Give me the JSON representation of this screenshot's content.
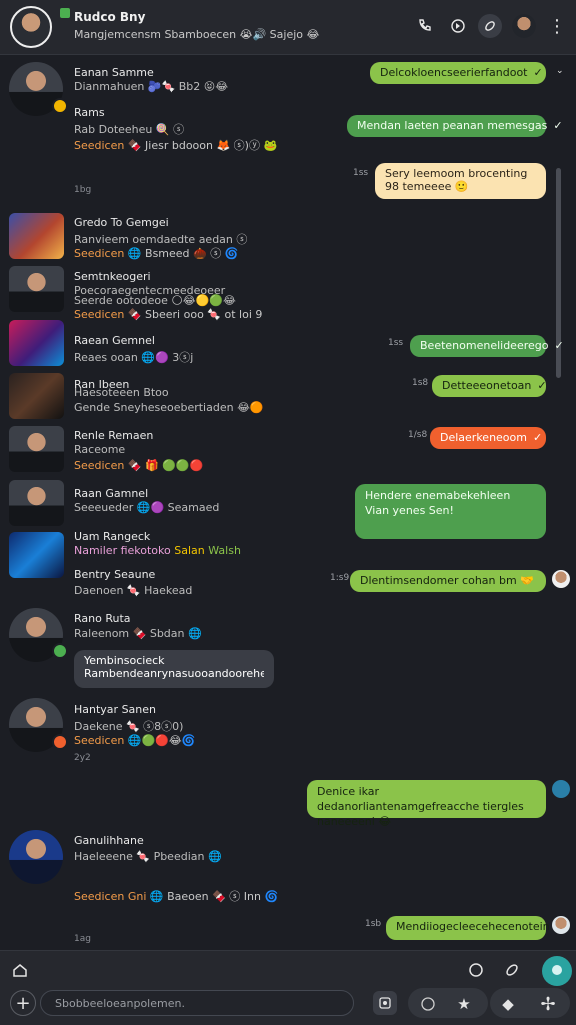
{
  "header": {
    "title": "Rudco Bny",
    "subtitle": "Mangjemcensm Sbamboecen 😭🔊 Sajejo 😂"
  },
  "chats": [
    {
      "name": "Eanan Samme",
      "line2": "Dianmahuen 🫐🍬 Bb2 😝😂",
      "time": ""
    },
    {
      "name": "Rams",
      "line2": "Rab Doteeheu 🍭 ⓢ",
      "line3a": "Seedicen",
      "line3b": " 🍫 Jiesr bdooon 🦊 ⓢ)ⓨ 🐸",
      "time": "1bg"
    },
    {
      "name": "Gredo To Gemgei",
      "line2": "Ranvieem oemdaedte aedan ⓢ",
      "line3a": "Seedicen",
      "line3b": " 🌐 Bsmeed 🌰 ⓢ 🌀",
      "time": ""
    },
    {
      "name": "Semtnkeogeri",
      "line2": "Poecoraegentecmeedeoeer",
      "line2b": "Seerde ootodeoe 🌕😂🟡🟢😂",
      "line3a": "Seedicen",
      "line3b": " 🍫 Sbeeri ooo 🍬 ot loi 9",
      "time": ""
    },
    {
      "name": "Raean Gemnel",
      "line2": "Reaes ooan 🌐🟣 3ⓢj",
      "time": ""
    },
    {
      "name": "Ran Ibeen",
      "line2": "Haesoteeen Btoo",
      "line2b": "Gende Sneyheseoebertiaden 😂🟠",
      "time": ""
    },
    {
      "name": "Renle Remaen",
      "line2": "Raceome",
      "line3a": "Seedicen",
      "line3b": " 🍫 🎁 🟢🟢🔴",
      "time": ""
    },
    {
      "name": "Raan Gamnel",
      "line2": "Seeeueder 🌐🟣 Seamaed",
      "time": ""
    },
    {
      "name": "Uam Rangeck",
      "line2a": "Namiler fiekotoko",
      "line2b": "Salan",
      "line2c": "Walsh",
      "time": ""
    },
    {
      "name": "Bentry Seaune",
      "line2": "Daenoen 🍬 Haekead",
      "time": ""
    },
    {
      "name": "Rano Ruta",
      "line2": "Raleenom 🍫 Sbdan 🌐",
      "time": ""
    },
    {
      "name": "Hantyar Sanen",
      "line2": "Daekene 🍬 ⓢ8ⓢ0)",
      "line3a": "Seedicen",
      "line3b": " 🌐🟢🔴😂🌀",
      "time": "2y2"
    },
    {
      "name": "Ganulihhane",
      "line2": "Haeleeene 🍬 Pbeedian 🌐",
      "line3a": "Seedicen Gni",
      "line3b": " 🌐 Baeoen 🍫 ⓢ Inn 🌀",
      "time": "1ag"
    }
  ],
  "incoming_bubble": {
    "line1": "Yembinsocieck",
    "line2": "Rambendeanrynasuooandooreheenge 🌀"
  },
  "bubbles": [
    {
      "text": "Delcokloencseerierfandoot",
      "style": "green"
    },
    {
      "text": "Mendan laeten peanan memesgas",
      "style": "teal"
    },
    {
      "text": "Sery leemoom brocenting 98 temeeee 🙂",
      "style": "cream",
      "time": "1ss"
    },
    {
      "text": "Beetenomenelideerego",
      "style": "teal",
      "time": "1ss"
    },
    {
      "text": "Detteeeonetoan",
      "style": "green",
      "time": "1s8"
    },
    {
      "text": "Delaerkeneoom",
      "style": "orange",
      "time": "1/s8"
    },
    {
      "text": "Hendere enemabekehleen Vian yenes Sen!",
      "style": "teal"
    },
    {
      "text": "Dlentimsendomer cohan bm 🤝",
      "style": "green",
      "time": "1:s9"
    },
    {
      "text": "Denice ikar dedanorliantenamgefreacche tiergles naneeeeni 😂",
      "style": "green"
    },
    {
      "text": "Mendiiogecleecehecenotein",
      "style": "green",
      "time": "1sb"
    }
  ],
  "compose": {
    "placeholder": "Sbobbeeloeanpolemen."
  },
  "colors": {
    "accent_green": "#8bc34a",
    "accent_teal": "#4e9f4e",
    "accent_orange": "#f0602e",
    "background": "#1c1e24"
  }
}
